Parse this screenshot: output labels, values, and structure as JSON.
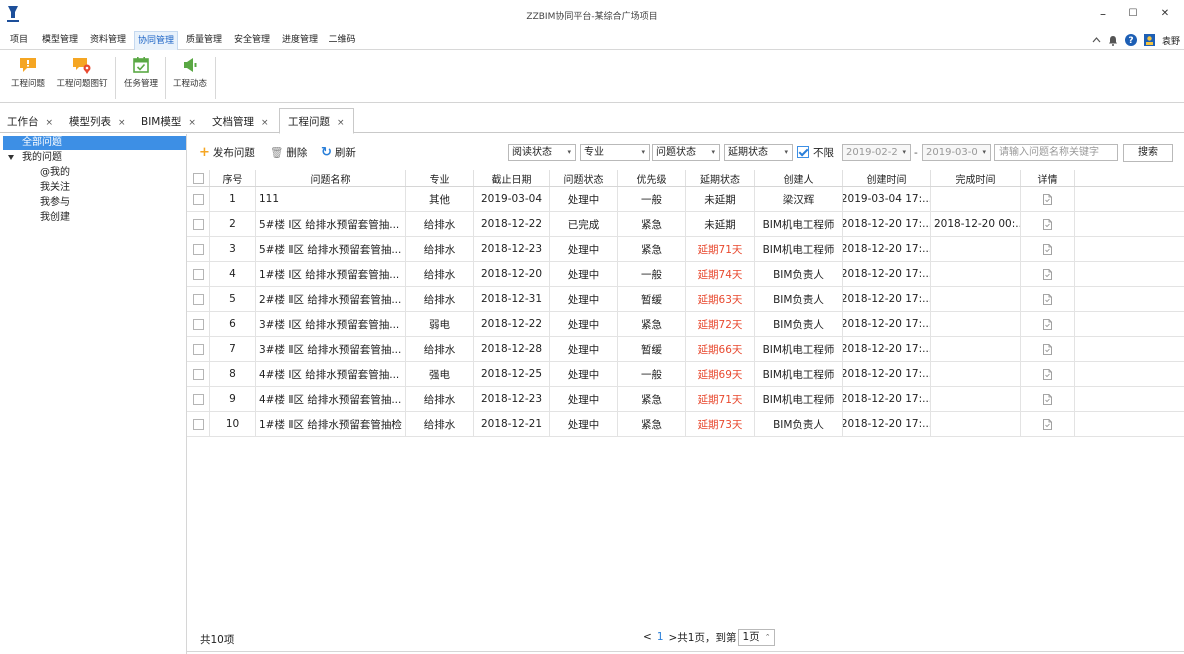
{
  "window": {
    "title": "ZZBIM协同平台-某综合广场项目",
    "minimize": "–",
    "maximize": "☐",
    "close": "✕"
  },
  "menu": [
    "项目",
    "模型管理",
    "资料管理",
    "协同管理",
    "质量管理",
    "安全管理",
    "进度管理",
    "二维码"
  ],
  "menu_active_index": 3,
  "user": {
    "name": "袁野"
  },
  "ribbon": {
    "buttons": [
      "工程问题",
      "工程问题图钉",
      "任务管理",
      "工程动态"
    ]
  },
  "doc_tabs": [
    "工作台",
    "模型列表",
    "BIM模型",
    "文档管理",
    "工程问题"
  ],
  "doc_tab_close": "×",
  "tree": {
    "root": "全部问题",
    "group": "我的问题",
    "children": [
      "@我的",
      "我关注",
      "我参与",
      "我创建"
    ]
  },
  "toolbar": {
    "publish": "发布问题",
    "delete": "删除",
    "refresh": "刷新",
    "publish_glyph": "+",
    "delete_glyph": "🗑",
    "refresh_glyph": "↻"
  },
  "filters": {
    "read_status": "阅读状态",
    "discipline": "专业",
    "issue_status": "问题状态",
    "delay_status": "延期状态",
    "unlimited_label": "不限",
    "date_start": "2019-02-2",
    "date_end": "2019-03-0",
    "search_placeholder": "请输入问题名称关键字",
    "search_button": "搜索",
    "dash": "-"
  },
  "table": {
    "columns": [
      "序号",
      "问题名称",
      "专业",
      "截止日期",
      "问题状态",
      "优先级",
      "延期状态",
      "创建人",
      "创建时间",
      "完成时间",
      "详情"
    ],
    "rows": [
      {
        "no": "1",
        "name": "111",
        "discipline": "其他",
        "due": "2019-03-04",
        "status": "处理中",
        "priority": "一般",
        "delay": "未延期",
        "delayed": false,
        "creator": "梁汉辉",
        "created": "2019-03-04 17:...",
        "finished": ""
      },
      {
        "no": "2",
        "name": "5#楼 Ⅰ区 给排水预留套管抽...",
        "discipline": "给排水",
        "due": "2018-12-22",
        "status": "已完成",
        "priority": "紧急",
        "delay": "未延期",
        "delayed": false,
        "creator": "BIM机电工程师",
        "created": "2018-12-20 17:...",
        "finished": "2018-12-20 00:..."
      },
      {
        "no": "3",
        "name": "5#楼 Ⅱ区 给排水预留套管抽...",
        "discipline": "给排水",
        "due": "2018-12-23",
        "status": "处理中",
        "priority": "紧急",
        "delay": "延期71天",
        "delayed": true,
        "creator": "BIM机电工程师",
        "created": "2018-12-20 17:...",
        "finished": ""
      },
      {
        "no": "4",
        "name": "1#楼 Ⅰ区 给排水预留套管抽...",
        "discipline": "给排水",
        "due": "2018-12-20",
        "status": "处理中",
        "priority": "一般",
        "delay": "延期74天",
        "delayed": true,
        "creator": "BIM负责人",
        "created": "2018-12-20 17:...",
        "finished": ""
      },
      {
        "no": "5",
        "name": "2#楼 Ⅱ区 给排水预留套管抽...",
        "discipline": "给排水",
        "due": "2018-12-31",
        "status": "处理中",
        "priority": "暂缓",
        "delay": "延期63天",
        "delayed": true,
        "creator": "BIM负责人",
        "created": "2018-12-20 17:...",
        "finished": ""
      },
      {
        "no": "6",
        "name": "3#楼 Ⅰ区 给排水预留套管抽...",
        "discipline": "弱电",
        "due": "2018-12-22",
        "status": "处理中",
        "priority": "紧急",
        "delay": "延期72天",
        "delayed": true,
        "creator": "BIM负责人",
        "created": "2018-12-20 17:...",
        "finished": ""
      },
      {
        "no": "7",
        "name": "3#楼 Ⅱ区 给排水预留套管抽...",
        "discipline": "给排水",
        "due": "2018-12-28",
        "status": "处理中",
        "priority": "暂缓",
        "delay": "延期66天",
        "delayed": true,
        "creator": "BIM机电工程师",
        "created": "2018-12-20 17:...",
        "finished": ""
      },
      {
        "no": "8",
        "name": "4#楼 Ⅰ区 给排水预留套管抽...",
        "discipline": "强电",
        "due": "2018-12-25",
        "status": "处理中",
        "priority": "一般",
        "delay": "延期69天",
        "delayed": true,
        "creator": "BIM机电工程师",
        "created": "2018-12-20 17:...",
        "finished": ""
      },
      {
        "no": "9",
        "name": "4#楼 Ⅱ区 给排水预留套管抽...",
        "discipline": "给排水",
        "due": "2018-12-23",
        "status": "处理中",
        "priority": "紧急",
        "delay": "延期71天",
        "delayed": true,
        "creator": "BIM机电工程师",
        "created": "2018-12-20 17:...",
        "finished": ""
      },
      {
        "no": "10",
        "name": "1#楼 Ⅱ区 给排水预留套管抽检",
        "discipline": "给排水",
        "due": "2018-12-21",
        "status": "处理中",
        "priority": "紧急",
        "delay": "延期73天",
        "delayed": true,
        "creator": "BIM负责人",
        "created": "2018-12-20 17:...",
        "finished": ""
      }
    ]
  },
  "footer": {
    "total": "共10项",
    "prev": "<",
    "page": "1",
    "next_text": ">共1页，到第",
    "page_select": "1页"
  },
  "colors": {
    "accent": "#3d8fe5",
    "delay_red": "#e8492f",
    "ribbon_orange": "#f5a623",
    "ribbon_green": "#5aa844"
  }
}
